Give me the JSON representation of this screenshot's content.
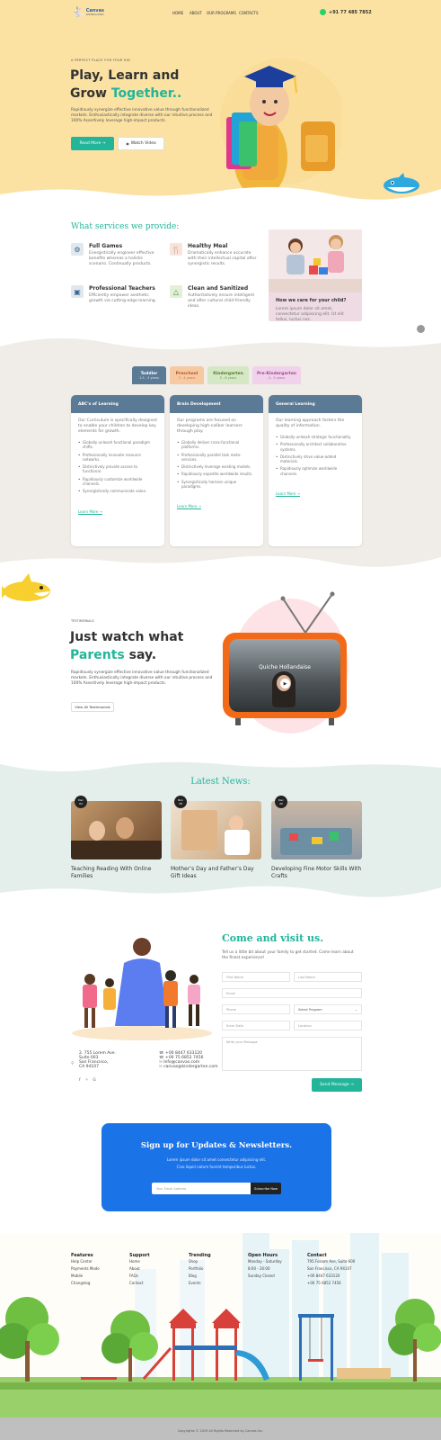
{
  "header": {
    "logo_text": "Canvas",
    "logo_sub": "KINDERGARTEN",
    "nav": [
      "HOME",
      "ABOUT",
      "OUR PROGRAMS",
      "CONTACTS"
    ],
    "phone": "+91 77 485 7852"
  },
  "hero": {
    "eyebrow": "A PERFECT PLACE FOR YOUR KID",
    "title_line1": "Play, Learn and",
    "title_line2a": "Grow ",
    "title_line2b": "Together..",
    "desc": "Rapidiously synergize effective innovative value through functionalized markets. Enthusiastically integrate diverse with our intuitive process and 100% Assertively leverage high-impact products.",
    "btn_primary": "Read More →",
    "btn_secondary": "Watch Video"
  },
  "services": {
    "heading": "What services we provide:",
    "items": [
      {
        "title": "Full Games",
        "desc": "Energistically engineer effective benefits whereas a holistic scenario. Continually products."
      },
      {
        "title": "Healthy Meal",
        "desc": "Dramatically enhance accurate with their intellectual capital after synergistic results."
      },
      {
        "title": "Professional Teachers",
        "desc": "Efficiently empower aesthetic growth via cutting-edge learning."
      },
      {
        "title": "Clean and Sanitized",
        "desc": "Authoritatively ensure intelligent and after cultural child-friendly ideas."
      }
    ],
    "care_title": "How we care for your child?",
    "care_desc": "Lorem ipsum dolor sit amet, consectetur adipiscing elit. Ut elit tellus, luctus nec."
  },
  "programs": {
    "tabs": [
      {
        "label": "Toddler",
        "sub": "1.5 - 3 years"
      },
      {
        "label": "Preschool",
        "sub": "3 - 4 years"
      },
      {
        "label": "Kindergarten",
        "sub": "5 - 6 years"
      },
      {
        "label": "Pre-Kindergarten",
        "sub": "4 - 5 years"
      }
    ],
    "cards": [
      {
        "title": "ABC's of Learning",
        "intro": "Our Curriculum is specifically designed to enable your children to develop key elements for growth.",
        "bullets": [
          "Globally unleash functional paradigm shifts.",
          "Professionally innovate resource networks.",
          "Distinctively provide access to functional.",
          "Rapidiously customize worldwide channels.",
          "Synergistically communicate value."
        ],
        "link": "Learn More →"
      },
      {
        "title": "Brain Development",
        "intro": "Our programs are focused on developing high-caliber learners through play.",
        "bullets": [
          "Globally deliver cross-functional platforms.",
          "Professionally parallel task meta-services.",
          "Distinctively leverage existing models.",
          "Rapidiously expedite worldwide results.",
          "Synergistically harness unique paradigms."
        ],
        "link": "Learn More →"
      },
      {
        "title": "General Learning",
        "intro": "Our learning approach fosters the quality of information.",
        "bullets": [
          "Globally unleash strategic functionality.",
          "Professionally architect collaborative systems.",
          "Distinctively drive value-added materials.",
          "Rapidiously optimize worldwide channels."
        ],
        "link": "Learn More →"
      }
    ]
  },
  "testimonials": {
    "eyebrow": "TESTIMONIALS",
    "title_line1": "Just watch what",
    "title_line2a": "Parents",
    "title_line2b": " say.",
    "desc": "Rapidiously synergize effective innovative value through functionalized markets. Enthusiastically integrate diverse with our intuitive process and 100% Assertively leverage high-impact products.",
    "button": "View All Testimonials",
    "video_name": "Quiche Hollandaise"
  },
  "news": {
    "heading": "Latest News:",
    "items": [
      {
        "day": "Dec",
        "num": "04",
        "title": "Teaching Reading With Online Families"
      },
      {
        "day": "Nov",
        "num": "28",
        "title": "Mother’s Day and Father’s Day Gift Ideas"
      },
      {
        "day": "Dec",
        "num": "20",
        "title": "Developing Fine Motor Skills With Crafts"
      }
    ]
  },
  "contact": {
    "heading": "Come and visit us.",
    "desc": "Tell us a little bit about your family to get started. Come learn about the finest experience!",
    "fields": {
      "first": "First Name",
      "last": "Last Name",
      "email": "Email",
      "phone": "Phone",
      "program": "Select Program",
      "date": "Enter Date",
      "location": "Location",
      "message": "Write your Message"
    },
    "submit": "Send Message →",
    "address": [
      "2. 755 Lorem Ave.",
      "Suite 003",
      "San Francisco,",
      "CA 94107"
    ],
    "phones": [
      "+00 8447 633120",
      "+00 75 6852 7456"
    ],
    "emails": [
      "Info@canvas.com",
      "canvas@kindergarten.com"
    ]
  },
  "newsletter": {
    "title": "Sign up for Updates & Newsletters.",
    "desc1": "Lorem ipsum dolor sit amet consectetur adipiscing elit.",
    "desc2": "Cras liquid natum fuerint temporibus luctus.",
    "placeholder": "Your Email Address",
    "button": "Subscribe Now"
  },
  "footer": {
    "cols": [
      {
        "head": "Features",
        "items": [
          "Help Center",
          "Payments Mode",
          "Mobile",
          "Changelog"
        ]
      },
      {
        "head": "Support",
        "items": [
          "Home",
          "About",
          "FAQs",
          "Contact"
        ]
      },
      {
        "head": "Trending",
        "items": [
          "Shop",
          "Portfolio",
          "Blog",
          "Events"
        ]
      },
      {
        "head": "Open Hours",
        "items": [
          "Monday - Saturday",
          "8:00 - 20:00",
          "Sunday Closed"
        ]
      },
      {
        "head": "Contact",
        "items": [
          "795 Folsom Ave, Suite 600",
          "San Francisco, CA 94107",
          "+00 8447 633120",
          "+00 75 6852 7456"
        ]
      }
    ],
    "copyright": "Copyrights © 2019 All Rights Reserved by Canvas Inc."
  },
  "colors": {
    "accent": "#22b59a",
    "hero_bg": "#fbe2a3",
    "blue": "#1b73e8"
  }
}
